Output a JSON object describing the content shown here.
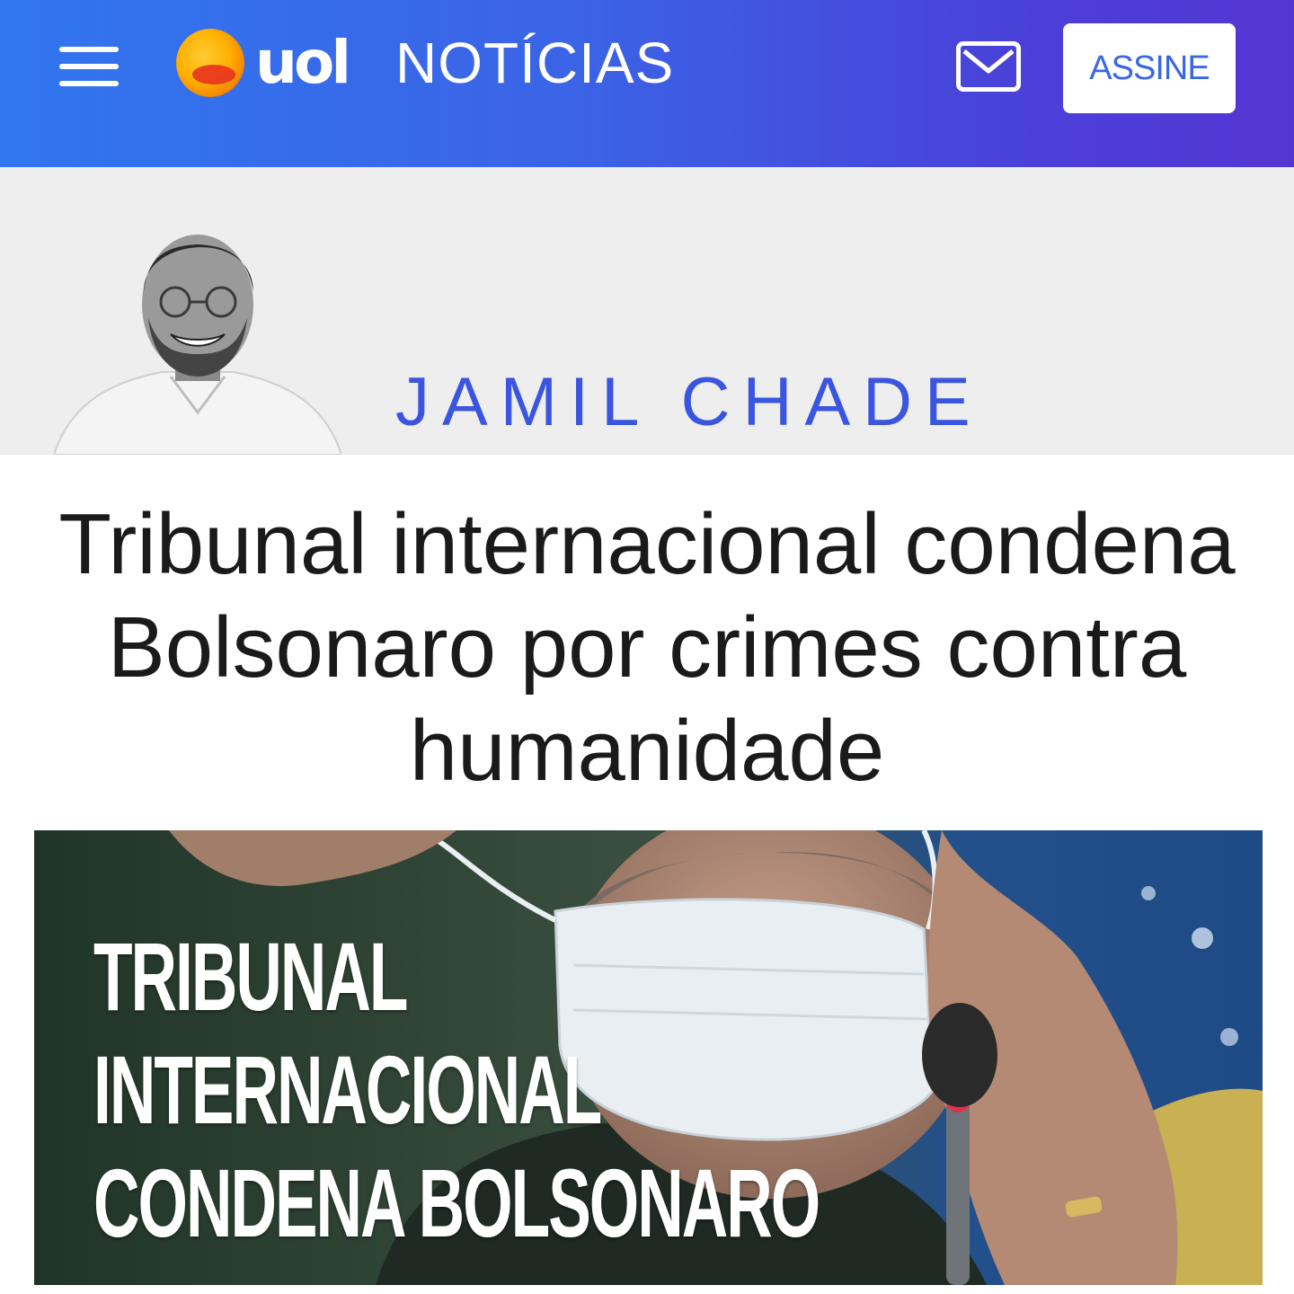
{
  "header": {
    "logo_text": "uol",
    "section": "NOTÍCIAS",
    "subscribe_label": "ASSINE"
  },
  "author": {
    "name": "JAMIL CHADE"
  },
  "article": {
    "headline": "Tribunal internacional condena Bolsonaro por crimes contra humanidade",
    "image_caption_lines": [
      "TRIBUNAL",
      "INTERNACIONAL",
      "CONDENA BOLSONARO"
    ]
  },
  "colors": {
    "header_gradient_start": "#3176ee",
    "header_gradient_end": "#5535d2",
    "author_name": "#3a55e0",
    "subscribe_text": "#3a68e3"
  },
  "icons": {
    "menu": "hamburger-icon",
    "mail": "envelope-icon",
    "logo": "uol-sun-logo"
  }
}
